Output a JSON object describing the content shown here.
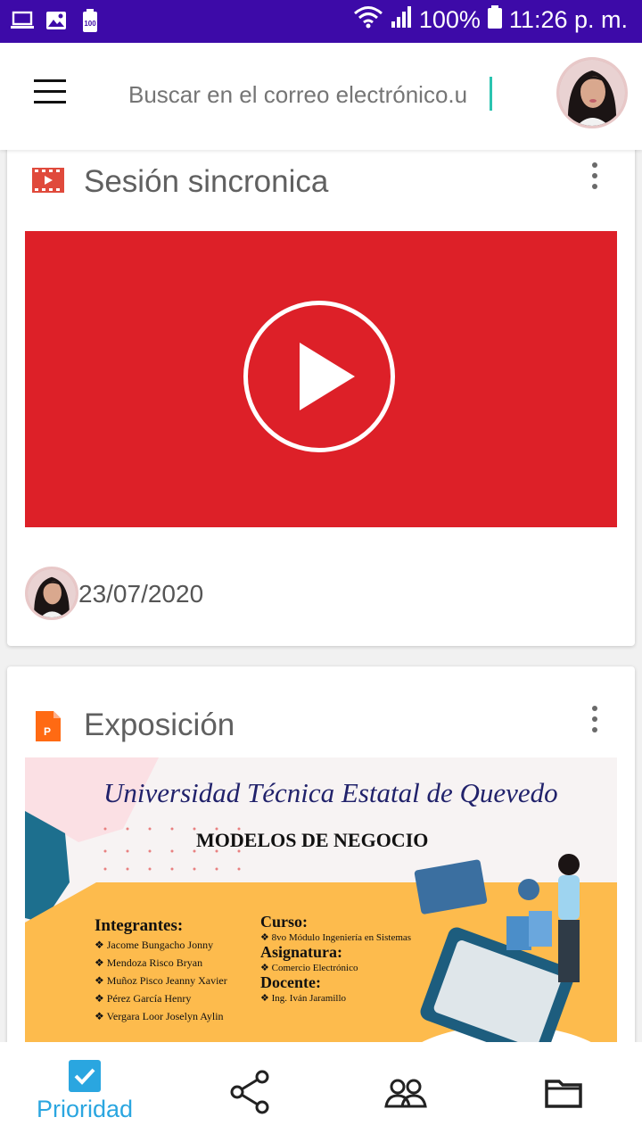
{
  "status_bar": {
    "battery_percent": "100%",
    "time": "11:26 p. m.",
    "left_icons": [
      "laptop-icon",
      "image-icon",
      "battery-100-icon"
    ],
    "right_icons": [
      "wifi-icon",
      "signal-icon",
      "battery-icon"
    ]
  },
  "header": {
    "search_placeholder": "Buscar en el correo electrónico.u",
    "menu_icon": "hamburger-menu-icon",
    "avatar": "profile-avatar"
  },
  "cards": [
    {
      "type_icon": "video-file-icon",
      "title": "Sesión sincronica",
      "date": "23/07/2020",
      "thumbnail": "youtube-play-thumbnail",
      "accent_color": "#dd2028"
    },
    {
      "type_icon": "powerpoint-file-icon",
      "title": "Exposición",
      "slide": {
        "university": "Universidad Técnica Estatal de Quevedo",
        "heading": "MODELOS DE NEGOCIO",
        "integrantes_label": "Integrantes:",
        "integrantes": [
          "Jacome Bungacho Jonny",
          "Mendoza Risco Bryan",
          "Muñoz Pisco Jeanny Xavier",
          "Pérez García Henry",
          "Vergara Loor Joselyn Aylin"
        ],
        "curso_label": "Curso:",
        "curso": "8vo Módulo Ingeniería en Sistemas",
        "asignatura_label": "Asignatura:",
        "asignatura": "Comercio Electrónico",
        "docente_label": "Docente:",
        "docente": "Ing. Iván Jaramillo"
      }
    }
  ],
  "bottom_nav": {
    "items": [
      {
        "label": "Prioridad",
        "icon": "checkbox-icon",
        "active": true
      },
      {
        "label": "",
        "icon": "share-icon"
      },
      {
        "label": "",
        "icon": "people-icon"
      },
      {
        "label": "",
        "icon": "folder-icon"
      }
    ],
    "active_color": "#2aa6e0"
  }
}
